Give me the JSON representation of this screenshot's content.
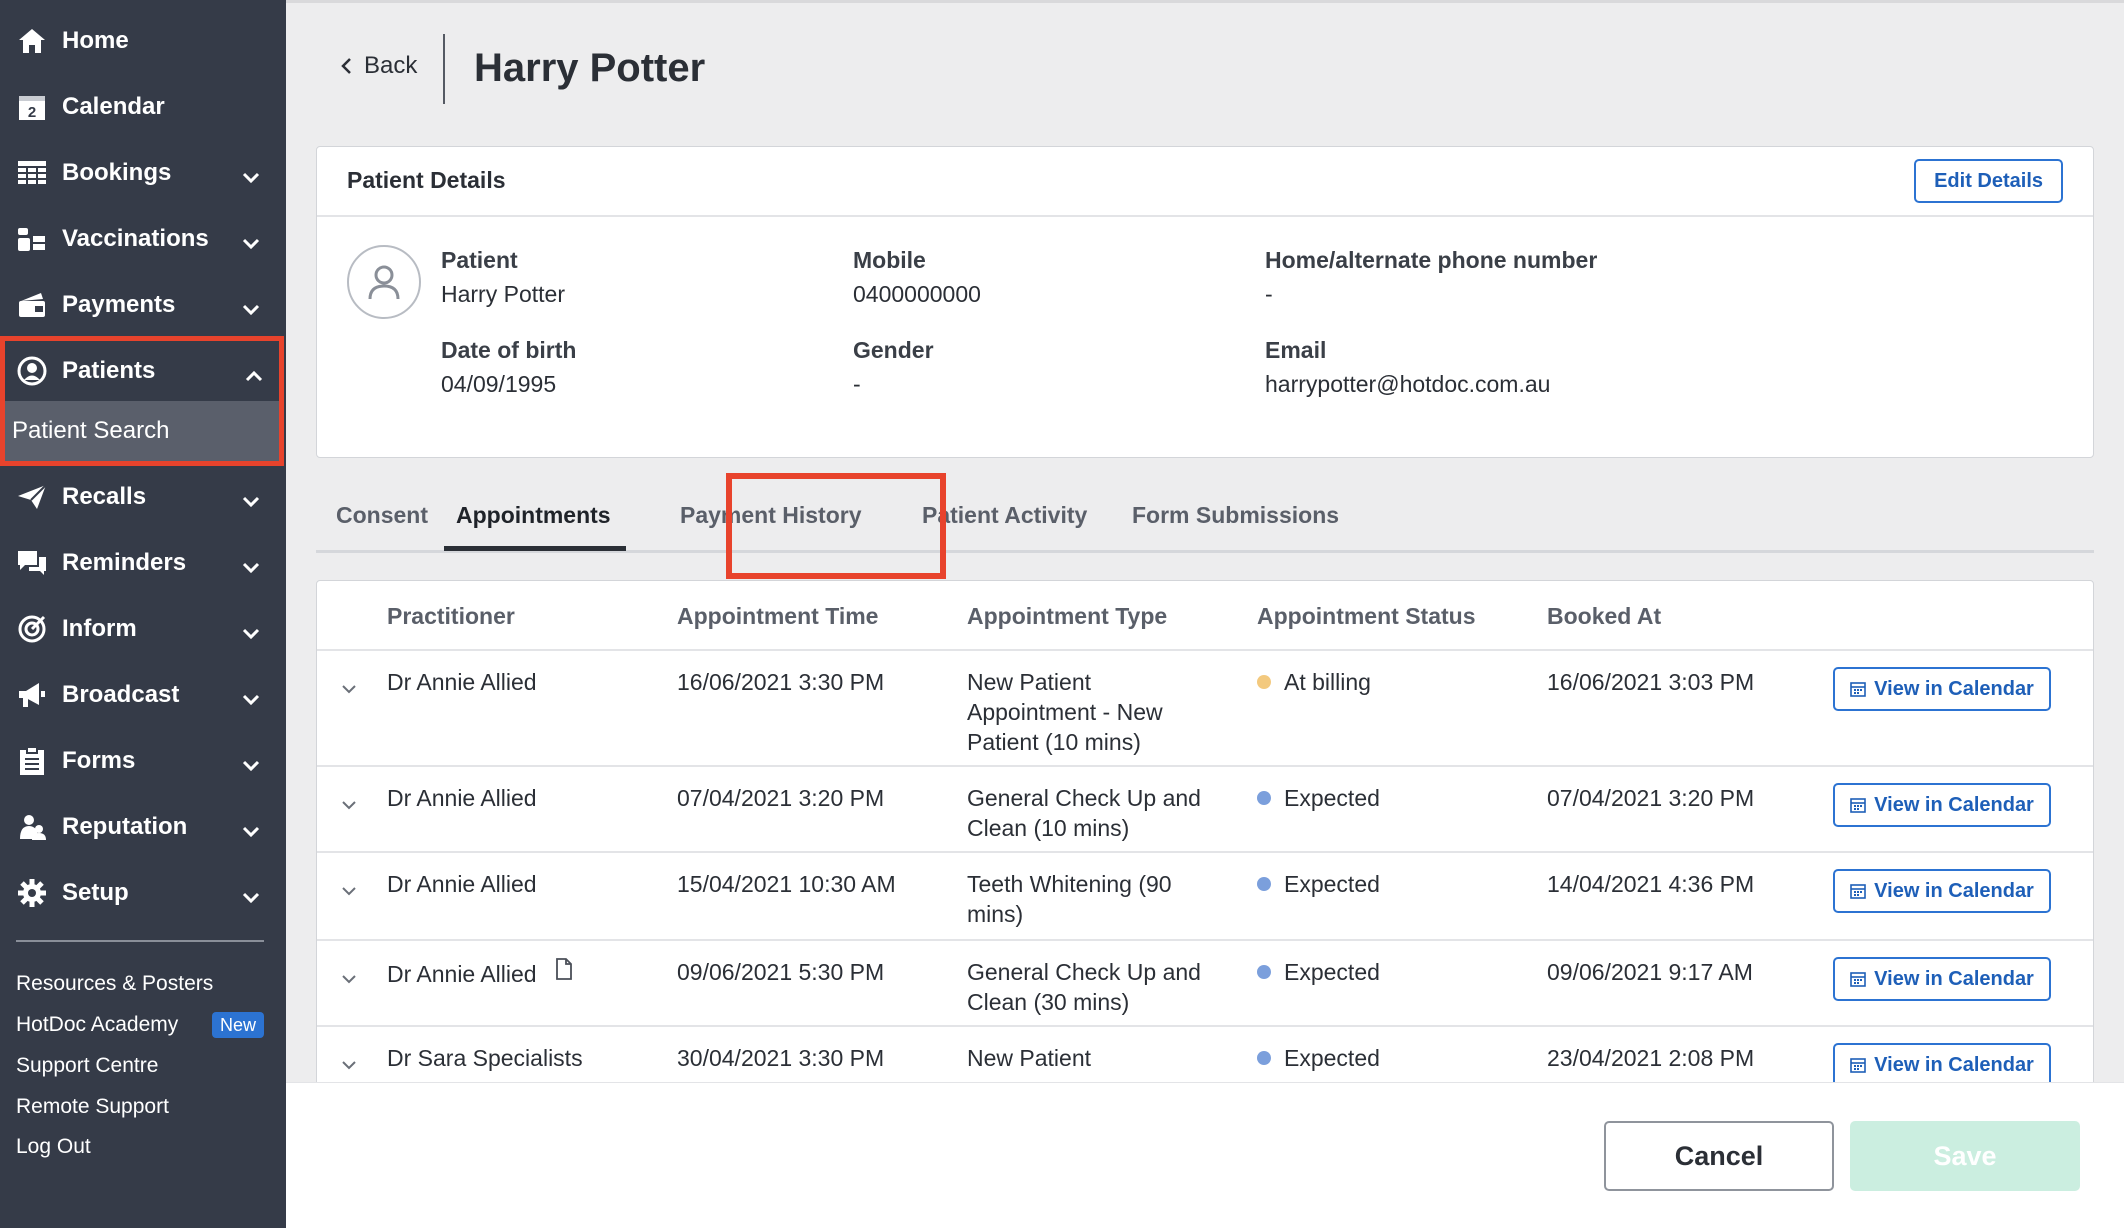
{
  "sidebar": {
    "items": [
      {
        "label": "Home",
        "icon": "home-icon"
      },
      {
        "label": "Calendar",
        "icon": "calendar-icon"
      },
      {
        "label": "Bookings",
        "icon": "bookings-grid-icon"
      },
      {
        "label": "Vaccinations",
        "icon": "vaccinations-icon"
      },
      {
        "label": "Payments",
        "icon": "payments-icon"
      },
      {
        "label": "Patients",
        "icon": "patient-circle-icon"
      },
      {
        "label": "Recalls",
        "icon": "paper-plane-icon"
      },
      {
        "label": "Reminders",
        "icon": "chat-bubbles-icon"
      },
      {
        "label": "Inform",
        "icon": "target-icon"
      },
      {
        "label": "Broadcast",
        "icon": "megaphone-icon"
      },
      {
        "label": "Forms",
        "icon": "clipboard-icon"
      },
      {
        "label": "Reputation",
        "icon": "people-icon"
      },
      {
        "label": "Setup",
        "icon": "gear-icon"
      }
    ],
    "calendar_day": "2",
    "patients_sub": "Patient Search",
    "links": [
      "Resources & Posters",
      "HotDoc Academy",
      "Support Centre",
      "Remote Support",
      "Log Out"
    ],
    "new_badge": "New"
  },
  "header": {
    "back_label": "Back",
    "title": "Harry Potter"
  },
  "patient_details": {
    "title": "Patient Details",
    "edit_label": "Edit Details",
    "fields": {
      "patient_label": "Patient",
      "patient_value": "Harry Potter",
      "mobile_label": "Mobile",
      "mobile_value": "0400000000",
      "home_label": "Home/alternate phone number",
      "home_value": "-",
      "dob_label": "Date of birth",
      "dob_value": "04/09/1995",
      "gender_label": "Gender",
      "gender_value": "-",
      "email_label": "Email",
      "email_value": "harrypotter@hotdoc.com.au"
    }
  },
  "tabs": [
    "Consent",
    "Appointments",
    "Payment History",
    "Patient Activity",
    "Form Submissions"
  ],
  "active_tab": "Appointments",
  "table": {
    "headers": [
      "Practitioner",
      "Appointment Time",
      "Appointment Type",
      "Appointment Status",
      "Booked At"
    ],
    "action_label": "View in Calendar",
    "rows": [
      {
        "practitioner": "Dr Annie Allied",
        "time": "16/06/2021 3:30 PM",
        "type": [
          "New Patient",
          "Appointment - New",
          "Patient (10 mins)"
        ],
        "status": "At billing",
        "status_color": "#f3c97e",
        "booked": "16/06/2021 3:03 PM"
      },
      {
        "practitioner": "Dr Annie Allied",
        "time": "07/04/2021 3:20 PM",
        "type": [
          "General Check Up and",
          "Clean (10 mins)"
        ],
        "status": "Expected",
        "status_color": "#7b9fdc",
        "booked": "07/04/2021 3:20 PM"
      },
      {
        "practitioner": "Dr Annie Allied",
        "time": "15/04/2021 10:30 AM",
        "type": [
          "Teeth Whitening (90",
          "mins)"
        ],
        "status": "Expected",
        "status_color": "#7b9fdc",
        "booked": "14/04/2021 4:36 PM"
      },
      {
        "practitioner": "Dr Annie Allied",
        "time": "09/06/2021 5:30 PM",
        "type": [
          "General Check Up and",
          "Clean (30 mins)"
        ],
        "status": "Expected",
        "status_color": "#7b9fdc",
        "booked": "09/06/2021 9:17 AM",
        "has_note_icon": true
      },
      {
        "practitioner": "Dr Sara Specialists",
        "time": "30/04/2021 3:30 PM",
        "type": [
          "New Patient"
        ],
        "status": "Expected",
        "status_color": "#7b9fdc",
        "booked": "23/04/2021 2:08 PM"
      }
    ]
  },
  "footer": {
    "cancel_label": "Cancel",
    "save_label": "Save"
  },
  "colors": {
    "sidebar_bg": "#353b48",
    "accent_blue": "#2c73d2",
    "highlight_red": "#e8432c",
    "save_disabled": "#cbeee0"
  }
}
